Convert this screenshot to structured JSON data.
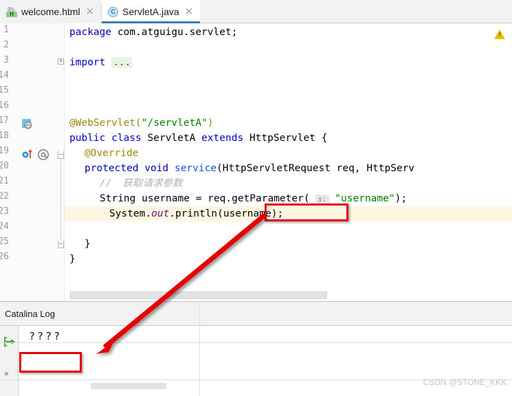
{
  "window": {
    "app": "IntelliJ IDEA"
  },
  "tabs": [
    {
      "label": "welcome.html",
      "icon": "html-file-icon",
      "icon_letter": "H",
      "active": false,
      "close": "×"
    },
    {
      "label": "ServletA.java",
      "icon": "java-class-icon",
      "icon_letter": "C",
      "active": true,
      "close": "×"
    }
  ],
  "editor": {
    "warning_icon": "warning-triangle-icon",
    "line_numbers": [
      "1",
      "2",
      "3",
      "14",
      "15",
      "16",
      "17",
      "18",
      "19",
      "20",
      "21",
      "22",
      "23",
      "24",
      "25",
      "26"
    ],
    "lines": [
      {
        "num": "1",
        "text": "package com.atguigu.servlet;",
        "highlight": false
      },
      {
        "num": "2",
        "text": "",
        "highlight": false
      },
      {
        "num": "3",
        "text": "import ...",
        "highlight": false
      },
      {
        "num": "14",
        "text": "",
        "highlight": false
      },
      {
        "num": "15",
        "text": "",
        "highlight": false
      },
      {
        "num": "16",
        "text": "@WebServlet(\"/servletA\")",
        "highlight": false
      },
      {
        "num": "17",
        "text": "public class ServletA extends HttpServlet {",
        "highlight": false
      },
      {
        "num": "18",
        "text": "    @Override",
        "highlight": false
      },
      {
        "num": "19",
        "text": "    protected void service(HttpServletRequest req, HttpServ",
        "highlight": false
      },
      {
        "num": "20",
        "text": "        //  获取请求参数",
        "highlight": false
      },
      {
        "num": "21",
        "text": "        String username = req.getParameter( s: \"username\");",
        "highlight": false
      },
      {
        "num": "22",
        "text": "        System.out.println(username);",
        "highlight": true
      },
      {
        "num": "23",
        "text": "",
        "highlight": false
      },
      {
        "num": "24",
        "text": "    }",
        "highlight": false
      },
      {
        "num": "25",
        "text": "}",
        "highlight": false
      },
      {
        "num": "26",
        "text": "",
        "highlight": false
      }
    ],
    "tokens": {
      "package": "package",
      "package_name": "com.atguigu.servlet;",
      "import": "import",
      "import_fold": "...",
      "webservlet_ann": "@WebServlet(",
      "webservlet_path": "\"/servletA\"",
      "webservlet_close": ")",
      "public": "public",
      "class": "class",
      "classname": "ServletA",
      "extends": "extends",
      "superclass": "HttpServlet {",
      "override": "@Override",
      "protected": "protected",
      "void": "void",
      "service": "service",
      "service_params": "(HttpServletRequest req, HttpServ",
      "comment_slashes": "//",
      "comment_text": "获取请求参数",
      "string_type": "String",
      "var_username": "username",
      "equals": "=",
      "req_call": "req.getParameter(",
      "param_hint": "s:",
      "param_value": "\"username\"",
      "call_close": ");",
      "system": "System.",
      "out": "out",
      "println": ".println(username);",
      "brace_inner": "}",
      "brace_outer": "}"
    },
    "gutter": {
      "servlet_marker_line": "17",
      "override_marker_line": "19",
      "override_icon": "override-arrow-icon",
      "annotation_icon": "at-sign-icon",
      "servlet_icon": "servlet-globe-icon"
    }
  },
  "panel": {
    "title": "Catalina Log",
    "log_output": "????",
    "jump_icon": "jump-to-source-icon",
    "more_icon": "more-chevron-icon"
  },
  "annotations": {
    "watermark": "CSDN @STONE_KKK",
    "highlight_color": "#e60000",
    "arrow": "red-annotation-arrow"
  }
}
